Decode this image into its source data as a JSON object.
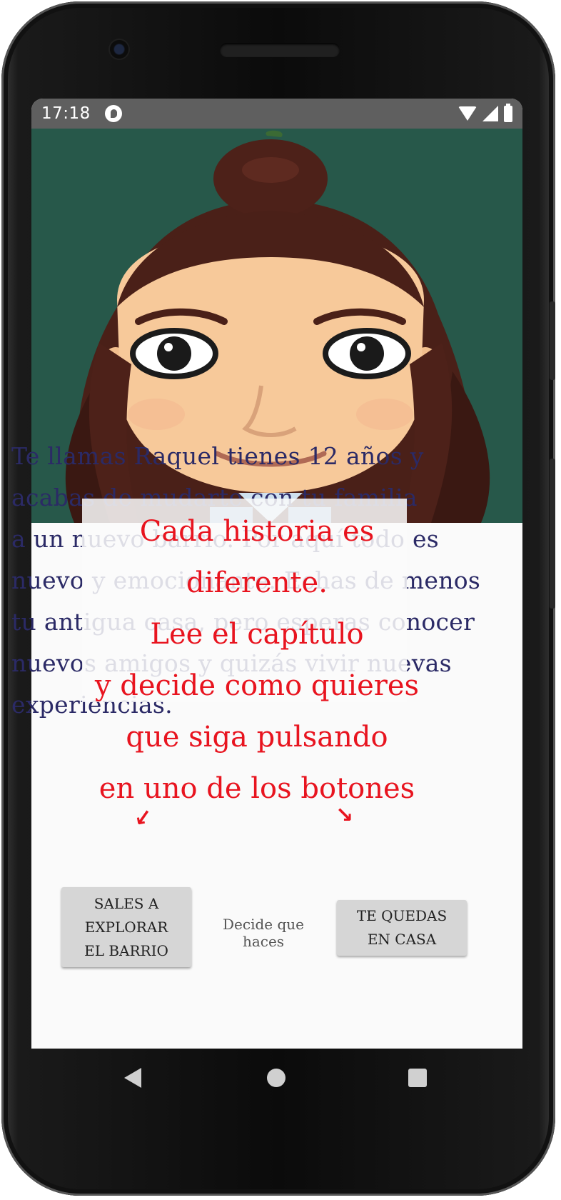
{
  "statusbar": {
    "time": "17:18",
    "icons": [
      "notification-icon",
      "wifi-icon",
      "signal-icon",
      "battery-icon"
    ]
  },
  "hero": {
    "image": "avatar-girl-illustration"
  },
  "story": {
    "lines": [
      "Te llamas Raquel tienes 12 años y",
      "acabas de mudarte con tu familia",
      "a un nuevo barrio. Por aquí todo es",
      "nuevo y emocionante. Echas de menos",
      "tu antigua casa, pero esperas conocer",
      "nuevos amigos y quizás vivir nuevas",
      "experiencias."
    ]
  },
  "tutorial_overlay": {
    "lines": [
      "Cada historia es",
      "diferente.",
      "Lee el capítulo",
      "y decide como quieres",
      "que siga pulsando",
      "en uno de los botones"
    ]
  },
  "choices": {
    "left_label": "SALES A EXPLORAR EL BARRIO",
    "prompt": "Decide que haces",
    "right_label": "TE QUEDAS EN CASA"
  },
  "colors": {
    "story_text": "#2b2a66",
    "overlay_text": "#e8141f",
    "statusbar": "#5f5f5f",
    "background_green": "#245446",
    "button": "#d6d6d6"
  }
}
